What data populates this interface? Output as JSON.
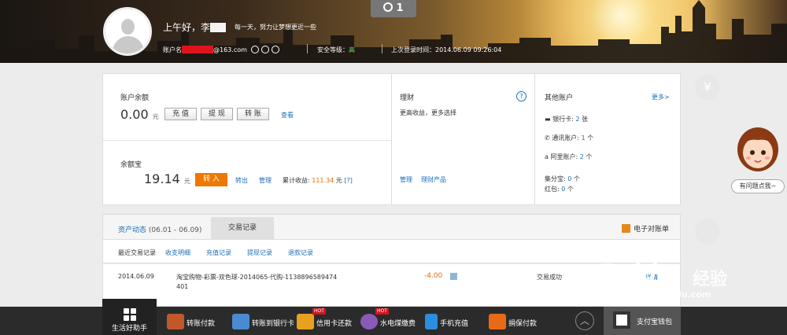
{
  "header": {
    "alarm_count": "1",
    "greeting": "上午好，李",
    "motto": "每一天，努力让梦想更近一些",
    "account_label": "账户名",
    "account_suffix": "@163.com",
    "security_label": "安全等级：",
    "security_value": "高",
    "last_login_label": "上次登录时间：",
    "last_login_value": "2014.06.09 09:26:04"
  },
  "balance": {
    "title": "账户余额",
    "amount": "0.00",
    "unit": "元",
    "recharge": "充 值",
    "withdraw": "提 现",
    "transfer": "转 账",
    "view": "查看"
  },
  "yuebao": {
    "title": "余额宝",
    "amount": "19.14",
    "unit": "元",
    "transfer_in": "转 入",
    "transfer_out": "转出",
    "manage": "管理",
    "cumulative_label": "累计收益:",
    "cumulative_value": "111.34",
    "cumulative_unit": "元",
    "help": "[?]"
  },
  "finance": {
    "title": "理财",
    "desc": "更高收益，更多选择",
    "help": "?",
    "manage": "管理",
    "products": "理财产品"
  },
  "other_accounts": {
    "title": "其他账户",
    "more": "更多>",
    "bank_label": "银行卡:",
    "bank_count": "2",
    "bank_unit": "张",
    "telecom_label": "通讯账户:",
    "telecom_count": "1",
    "telecom_unit": "个",
    "ali_label": "阿里账户:",
    "ali_count": "2",
    "ali_unit": "个",
    "jifen_label": "集分宝:",
    "jifen_count": "0",
    "jifen_unit": "个",
    "hongbao_label": "红包:",
    "hongbao_count": "0",
    "hongbao_unit": "个"
  },
  "tabs": {
    "assets": "资产动态",
    "assets_range": "(06.01 - 06.09)",
    "records": "交易记录",
    "ebill": "电子对账单"
  },
  "subnav": {
    "recent": "最近交易记录",
    "income": "收支明细",
    "recharge": "充值记录",
    "withdraw": "提现记录",
    "refund": "退款记录"
  },
  "transaction": {
    "date": "2014.06.09",
    "desc_line1": "淘宝购物-彩票-双色球-2014065-代购-1138896589474",
    "desc_line2": "401",
    "amount": "-4.00",
    "status": "交易成功",
    "detail": "详情"
  },
  "side": {
    "yen": "¥",
    "help_bubble": "有问题点我~"
  },
  "bottom_bar": {
    "life_helper": "生活好助手",
    "items": [
      "转账付款",
      "转账到银行卡",
      "信用卡还款",
      "水电煤缴费",
      "手机充值",
      "捐保付款"
    ],
    "hot": "HOT",
    "wallet": "支付宝钱包"
  },
  "watermark": {
    "brand": "Bai",
    "brand2": "du",
    "jingyan": "经验",
    "url": "jingyan.baidu.com"
  },
  "colors": {
    "accent_blue": "#1a6fb9",
    "orange": "#f07800",
    "amount_orange": "#e86c00",
    "security_green": "#66d06a",
    "redact_red": "#e0131d"
  }
}
